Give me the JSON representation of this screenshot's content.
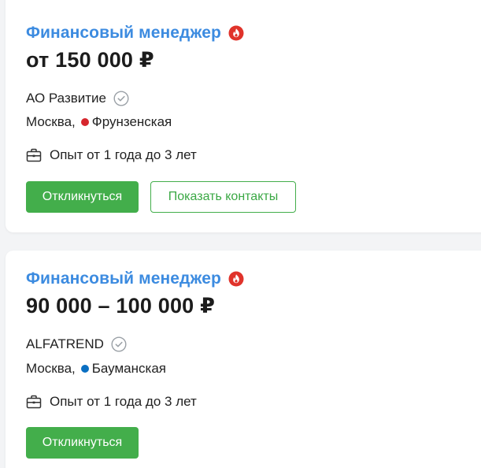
{
  "vacancies": [
    {
      "title": "Финансовый менеджер",
      "salary": "от 150 000 ₽",
      "company": "АО Развитие",
      "city": "Москва,",
      "metro": "Фрунзенская",
      "metro_color": "#d6262d",
      "experience": "Опыт от 1 года до 3 лет",
      "respond_label": "Откликнуться",
      "contacts_label": "Показать контакты",
      "hot_icon": "fire-icon",
      "verified_icon": "check-circle-icon"
    },
    {
      "title": "Финансовый менеджер",
      "salary": "90 000 – 100 000 ₽",
      "company": "ALFATREND",
      "city": "Москва,",
      "metro": "Бауманская",
      "metro_color": "#0a6fc2",
      "experience": "Опыт от 1 года до 3 лет",
      "respond_label": "Откликнуться",
      "hot_icon": "fire-icon",
      "verified_icon": "check-circle-icon"
    }
  ],
  "colors": {
    "title": "#3c8be0",
    "accent_green": "#43ae4b",
    "hot_red": "#e0332b"
  }
}
